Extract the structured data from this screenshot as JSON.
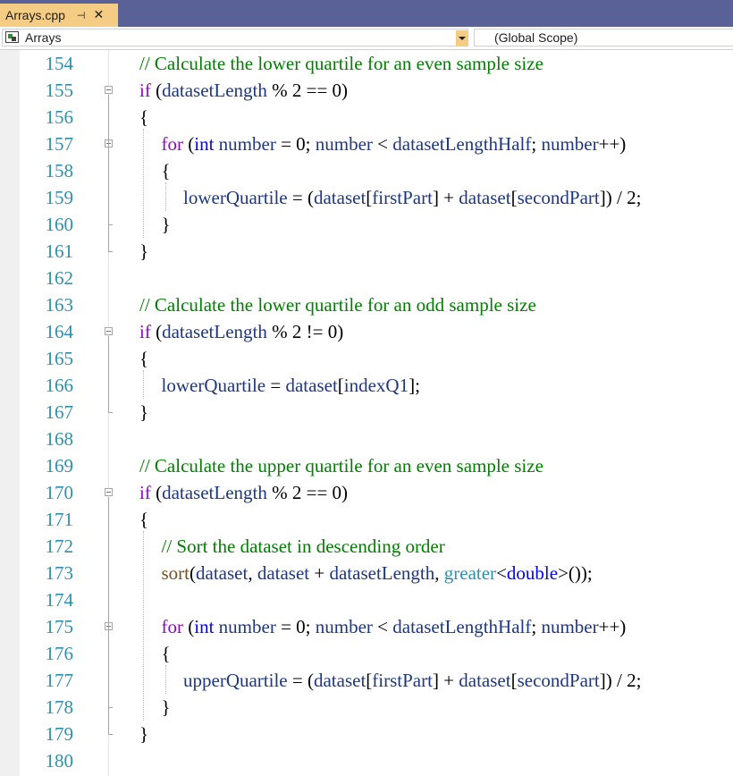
{
  "tab": {
    "title": "Arrays.cpp",
    "pin_glyph": "⊣",
    "close_glyph": "✕"
  },
  "nav": {
    "left_label": "Arrays",
    "right_label": "(Global Scope)"
  },
  "editor": {
    "lines": [
      {
        "n": "154",
        "indent": 1,
        "parts": [
          {
            "t": "c",
            "s": "// Calculate the lower quartile for an even sample size"
          }
        ]
      },
      {
        "n": "155",
        "indent": 1,
        "fold": true,
        "parts": [
          {
            "t": "k",
            "s": "if"
          },
          {
            "t": "p",
            "s": " ("
          },
          {
            "t": "v",
            "s": "datasetLength"
          },
          {
            "t": "p",
            "s": " % 2 == 0)"
          }
        ]
      },
      {
        "n": "156",
        "indent": 1,
        "parts": [
          {
            "t": "p",
            "s": "{"
          }
        ]
      },
      {
        "n": "157",
        "indent": 2,
        "fold": true,
        "parts": [
          {
            "t": "k",
            "s": "for"
          },
          {
            "t": "p",
            "s": " ("
          },
          {
            "t": "t",
            "s": "int"
          },
          {
            "t": "p",
            "s": " "
          },
          {
            "t": "v",
            "s": "number"
          },
          {
            "t": "p",
            "s": " = 0; "
          },
          {
            "t": "v",
            "s": "number"
          },
          {
            "t": "p",
            "s": " < "
          },
          {
            "t": "v",
            "s": "datasetLengthHalf"
          },
          {
            "t": "p",
            "s": "; "
          },
          {
            "t": "v",
            "s": "number"
          },
          {
            "t": "p",
            "s": "++)"
          }
        ]
      },
      {
        "n": "158",
        "indent": 2,
        "parts": [
          {
            "t": "p",
            "s": "{"
          }
        ]
      },
      {
        "n": "159",
        "indent": 3,
        "parts": [
          {
            "t": "v",
            "s": "lowerQuartile"
          },
          {
            "t": "p",
            "s": " = ("
          },
          {
            "t": "v",
            "s": "dataset"
          },
          {
            "t": "p",
            "s": "["
          },
          {
            "t": "v",
            "s": "firstPart"
          },
          {
            "t": "p",
            "s": "] + "
          },
          {
            "t": "v",
            "s": "dataset"
          },
          {
            "t": "p",
            "s": "["
          },
          {
            "t": "v",
            "s": "secondPart"
          },
          {
            "t": "p",
            "s": "]) / 2;"
          }
        ]
      },
      {
        "n": "160",
        "indent": 2,
        "parts": [
          {
            "t": "p",
            "s": "}"
          }
        ]
      },
      {
        "n": "161",
        "indent": 1,
        "parts": [
          {
            "t": "p",
            "s": "}"
          }
        ]
      },
      {
        "n": "162",
        "indent": 1,
        "parts": []
      },
      {
        "n": "163",
        "indent": 1,
        "parts": [
          {
            "t": "c",
            "s": "// Calculate the lower quartile for an odd sample size"
          }
        ]
      },
      {
        "n": "164",
        "indent": 1,
        "fold": true,
        "parts": [
          {
            "t": "k",
            "s": "if"
          },
          {
            "t": "p",
            "s": " ("
          },
          {
            "t": "v",
            "s": "datasetLength"
          },
          {
            "t": "p",
            "s": " % 2 != 0)"
          }
        ]
      },
      {
        "n": "165",
        "indent": 1,
        "parts": [
          {
            "t": "p",
            "s": "{"
          }
        ]
      },
      {
        "n": "166",
        "indent": 2,
        "parts": [
          {
            "t": "v",
            "s": "lowerQuartile"
          },
          {
            "t": "p",
            "s": " = "
          },
          {
            "t": "v",
            "s": "dataset"
          },
          {
            "t": "p",
            "s": "["
          },
          {
            "t": "v",
            "s": "indexQ1"
          },
          {
            "t": "p",
            "s": "];"
          }
        ]
      },
      {
        "n": "167",
        "indent": 1,
        "parts": [
          {
            "t": "p",
            "s": "}"
          }
        ]
      },
      {
        "n": "168",
        "indent": 1,
        "parts": []
      },
      {
        "n": "169",
        "indent": 1,
        "parts": [
          {
            "t": "c",
            "s": "// Calculate the upper quartile for an even sample size"
          }
        ]
      },
      {
        "n": "170",
        "indent": 1,
        "fold": true,
        "parts": [
          {
            "t": "k",
            "s": "if"
          },
          {
            "t": "p",
            "s": " ("
          },
          {
            "t": "v",
            "s": "datasetLength"
          },
          {
            "t": "p",
            "s": " % 2 == 0)"
          }
        ]
      },
      {
        "n": "171",
        "indent": 1,
        "parts": [
          {
            "t": "p",
            "s": "{"
          }
        ]
      },
      {
        "n": "172",
        "indent": 2,
        "parts": [
          {
            "t": "c",
            "s": "// Sort the dataset in descending order"
          }
        ]
      },
      {
        "n": "173",
        "indent": 2,
        "parts": [
          {
            "t": "f",
            "s": "sort"
          },
          {
            "t": "p",
            "s": "("
          },
          {
            "t": "v",
            "s": "dataset"
          },
          {
            "t": "p",
            "s": ", "
          },
          {
            "t": "v",
            "s": "dataset"
          },
          {
            "t": "p",
            "s": " + "
          },
          {
            "t": "v",
            "s": "datasetLength"
          },
          {
            "t": "p",
            "s": ", "
          },
          {
            "t": "tn",
            "s": "greater"
          },
          {
            "t": "p",
            "s": "<"
          },
          {
            "t": "t",
            "s": "double"
          },
          {
            "t": "p",
            "s": ">());"
          }
        ]
      },
      {
        "n": "174",
        "indent": 2,
        "parts": []
      },
      {
        "n": "175",
        "indent": 2,
        "fold": true,
        "parts": [
          {
            "t": "k",
            "s": "for"
          },
          {
            "t": "p",
            "s": " ("
          },
          {
            "t": "t",
            "s": "int"
          },
          {
            "t": "p",
            "s": " "
          },
          {
            "t": "v",
            "s": "number"
          },
          {
            "t": "p",
            "s": " = 0; "
          },
          {
            "t": "v",
            "s": "number"
          },
          {
            "t": "p",
            "s": " < "
          },
          {
            "t": "v",
            "s": "datasetLengthHalf"
          },
          {
            "t": "p",
            "s": "; "
          },
          {
            "t": "v",
            "s": "number"
          },
          {
            "t": "p",
            "s": "++)"
          }
        ]
      },
      {
        "n": "176",
        "indent": 2,
        "parts": [
          {
            "t": "p",
            "s": "{"
          }
        ]
      },
      {
        "n": "177",
        "indent": 3,
        "parts": [
          {
            "t": "v",
            "s": "upperQuartile"
          },
          {
            "t": "p",
            "s": " = ("
          },
          {
            "t": "v",
            "s": "dataset"
          },
          {
            "t": "p",
            "s": "["
          },
          {
            "t": "v",
            "s": "firstPart"
          },
          {
            "t": "p",
            "s": "] + "
          },
          {
            "t": "v",
            "s": "dataset"
          },
          {
            "t": "p",
            "s": "["
          },
          {
            "t": "v",
            "s": "secondPart"
          },
          {
            "t": "p",
            "s": "]) / 2;"
          }
        ]
      },
      {
        "n": "178",
        "indent": 2,
        "parts": [
          {
            "t": "p",
            "s": "}"
          }
        ]
      },
      {
        "n": "179",
        "indent": 1,
        "parts": [
          {
            "t": "p",
            "s": "}"
          }
        ]
      },
      {
        "n": "180",
        "indent": 1,
        "parts": []
      }
    ]
  }
}
